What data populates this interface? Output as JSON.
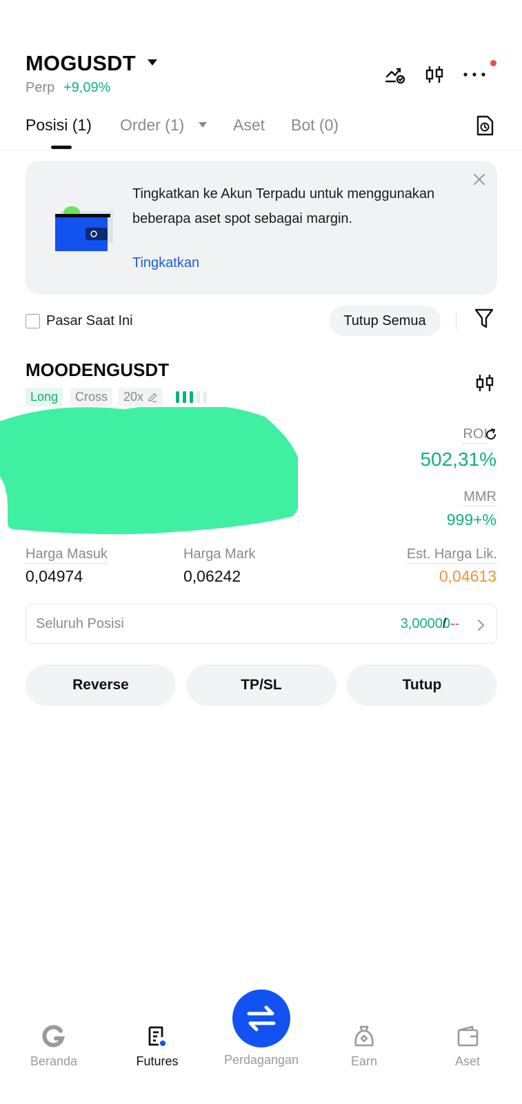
{
  "header": {
    "symbol": "MOGUSDT",
    "perp_label": "Perp",
    "change_pct": "+9,09%",
    "icons": [
      "strategy-icon",
      "candlestick-icon",
      "more-icon"
    ]
  },
  "tabs": [
    {
      "label": "Posisi (1)",
      "active": true
    },
    {
      "label": "Order (1)",
      "active": false
    },
    {
      "label": "Aset",
      "active": false
    },
    {
      "label": "Bot (0)",
      "active": false
    }
  ],
  "banner": {
    "text": "Tingkatkan ke Akun Terpadu untuk menggunakan beberapa aset spot sebagai margin.",
    "link": "Tingkatkan"
  },
  "filters": {
    "checkbox_label": "Pasar Saat Ini",
    "close_all": "Tutup Semua"
  },
  "position": {
    "symbol": "MOODENGUSDT",
    "side": "Long",
    "margin_mode": "Cross",
    "leverage": "20x",
    "adl_level": 3,
    "roi_label": "ROI",
    "roi_value": "502,31%",
    "mmr_label": "MMR",
    "mmr_value": "999+%",
    "entry_label": "Harga Masuk",
    "entry_value": "0,04974",
    "mark_label": "Harga Mark",
    "mark_value": "0,06242",
    "liq_label": "Est. Harga Lik.",
    "liq_value": "0,04613",
    "all_position_label": "Seluruh Posisi",
    "all_position_value": "3,00000",
    "all_position_sep": " /",
    "all_position_dash": "--",
    "buttons": {
      "reverse": "Reverse",
      "tpsl": "TP/SL",
      "close": "Tutup"
    }
  },
  "nav": [
    {
      "label": "Beranda",
      "icon": "home-icon",
      "active": false
    },
    {
      "label": "Futures",
      "icon": "futures-icon",
      "active": true
    },
    {
      "label": "Perdagangan",
      "icon": "swap-icon",
      "active": false
    },
    {
      "label": "Earn",
      "icon": "earn-icon",
      "active": false
    },
    {
      "label": "Aset",
      "icon": "wallet-icon",
      "active": false
    }
  ],
  "colors": {
    "green": "#10b27a",
    "orange": "#f0933a",
    "blue": "#1252f0",
    "link_blue": "#1a5fd6",
    "red": "#e0405c",
    "scribble": "#3ff0a2"
  }
}
